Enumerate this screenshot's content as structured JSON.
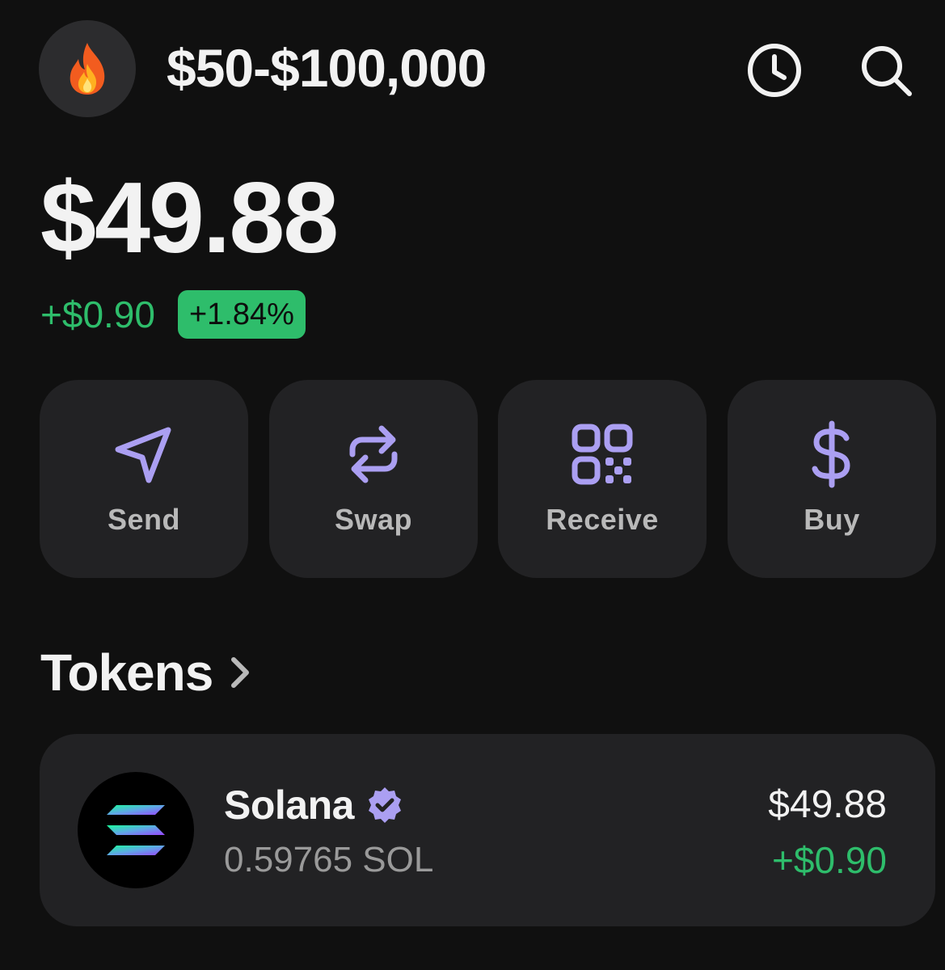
{
  "header": {
    "avatar_icon": "fire-emoji",
    "account_name": "$50-$100,000",
    "history_icon": "clock-icon",
    "search_icon": "search-icon"
  },
  "balance": {
    "total": "$49.88",
    "change_amount": "+$0.90",
    "change_percent": "+1.84%"
  },
  "actions": [
    {
      "label": "Send",
      "icon": "send-icon"
    },
    {
      "label": "Swap",
      "icon": "swap-icon"
    },
    {
      "label": "Receive",
      "icon": "qr-code-icon"
    },
    {
      "label": "Buy",
      "icon": "dollar-icon"
    }
  ],
  "tokens": {
    "title": "Tokens",
    "items": [
      {
        "name": "Solana",
        "verified": true,
        "amount": "0.59765 SOL",
        "value": "$49.88",
        "change": "+$0.90"
      }
    ]
  },
  "colors": {
    "background": "#101010",
    "card": "#222224",
    "accent_purple": "#ab9ff2",
    "positive_green": "#2ebd6b"
  }
}
